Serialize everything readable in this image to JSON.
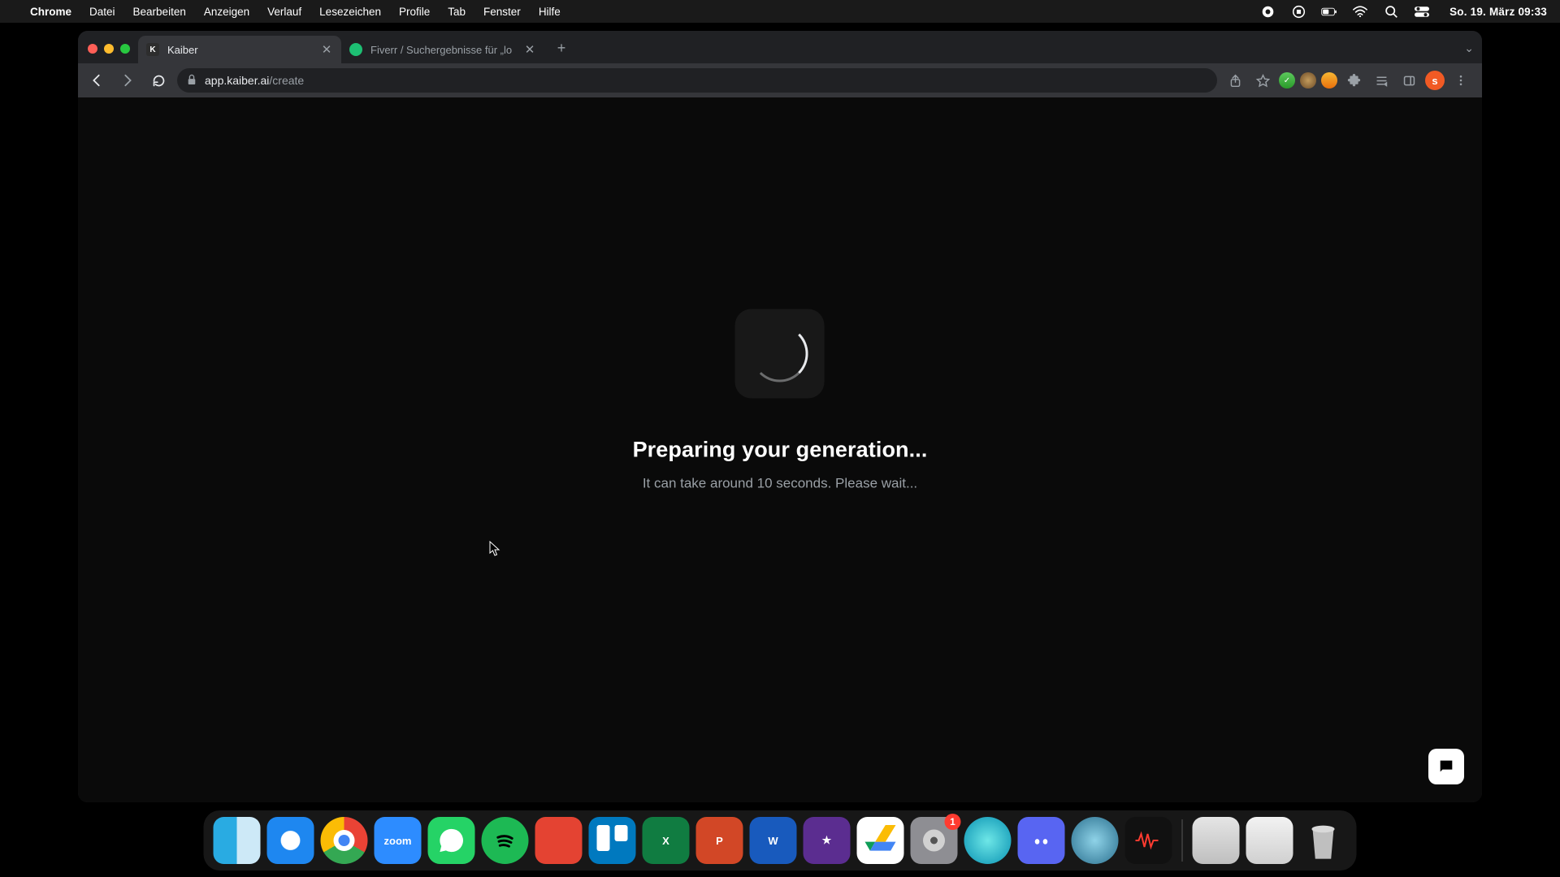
{
  "menubar": {
    "app_name": "Chrome",
    "items": [
      "Datei",
      "Bearbeiten",
      "Anzeigen",
      "Verlauf",
      "Lesezeichen",
      "Profile",
      "Tab",
      "Fenster",
      "Hilfe"
    ],
    "clock": "So. 19. März  09:33"
  },
  "browser": {
    "tabs": [
      {
        "title": "Kaiber",
        "active": true,
        "favicon_letter": "K"
      },
      {
        "title": "Fiverr / Suchergebnisse für „lo",
        "active": false
      }
    ],
    "url_host": "app.kaiber.ai",
    "url_path": "/create",
    "avatar_initial": "s"
  },
  "page": {
    "headline": "Preparing your generation...",
    "subline": "It can take around 10 seconds. Please wait..."
  },
  "dock": {
    "badge_settings": "1"
  }
}
